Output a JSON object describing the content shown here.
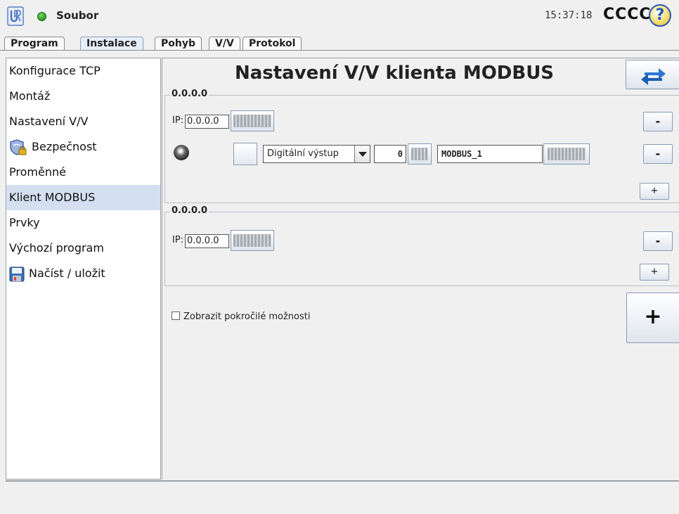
{
  "header": {
    "app_menu": "Soubor",
    "clock": "15:37:18",
    "robot_name": "CCCC",
    "help_icon": "?",
    "colors": {
      "status": "#2a9a20",
      "accent": "#2b56b5"
    }
  },
  "tabs": [
    {
      "label": "Program",
      "active": false
    },
    {
      "label": "Instalace",
      "active": true
    },
    {
      "label": "Pohyb",
      "active": false
    },
    {
      "label": "V/V",
      "active": false
    },
    {
      "label": "Protokol",
      "active": false
    }
  ],
  "sidebar": {
    "items": [
      {
        "label": "Konfigurace TCP"
      },
      {
        "label": "Montáž"
      },
      {
        "label": "Nastavení V/V"
      },
      {
        "label": "Bezpečnost",
        "icon": "shield-lock-icon"
      },
      {
        "label": "Proměnné"
      },
      {
        "label": "Klient MODBUS",
        "selected": true
      },
      {
        "label": "Prvky"
      },
      {
        "label": "Výchozí program"
      },
      {
        "label": "Načíst / uložit",
        "icon": "floppy-icon"
      }
    ]
  },
  "main": {
    "title": "Nastavení V/V klienta MODBUS",
    "units": [
      {
        "legend": "0.0.0.0",
        "ip_label": "IP:",
        "ip_value": "0.0.0.0",
        "remove_label": "-",
        "signal": {
          "type": "Digitální výstup",
          "address": "0",
          "name": "MODBUS_1",
          "remove_label": "-"
        },
        "add_signal_label": "+"
      },
      {
        "legend": "0.0.0.0",
        "ip_label": "IP:",
        "ip_value": "0.0.0.0",
        "remove_label": "-",
        "add_signal_label": "+"
      }
    ],
    "advanced_options_label": "Zobrazit pokročilé možnosti",
    "add_unit_label": "+"
  }
}
